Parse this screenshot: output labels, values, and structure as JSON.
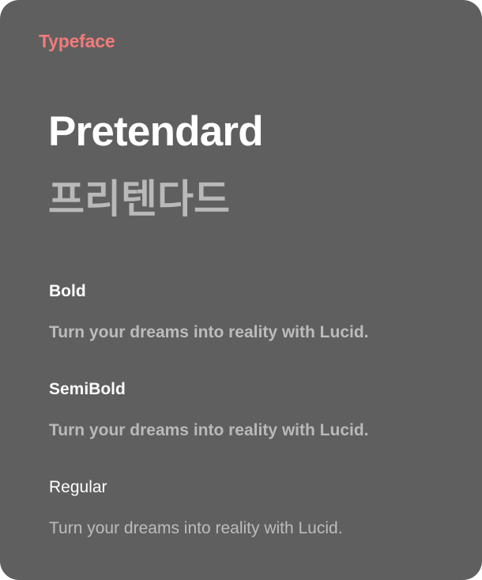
{
  "card": {
    "label": "Typeface",
    "label_color": "#f27b7b",
    "title": "Pretendard",
    "title_ko": "프리텐다드",
    "weights": [
      {
        "name": "Bold",
        "sample": "Turn your dreams into reality with Lucid."
      },
      {
        "name": "SemiBold",
        "sample": "Turn your dreams into reality with Lucid."
      },
      {
        "name": "Regular",
        "sample": "Turn your dreams into reality with Lucid."
      }
    ]
  },
  "colors": {
    "background": "#5f5f5f",
    "title": "#ffffff",
    "subtitle": "#b9b9b9",
    "sample_text": "#bcbcbc"
  }
}
